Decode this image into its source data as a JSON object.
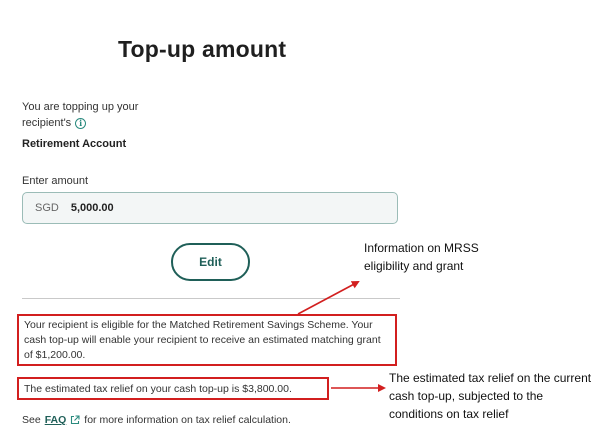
{
  "header": {
    "title": "Top-up amount"
  },
  "intro": {
    "line1": "You are topping up your",
    "line2": "recipient's",
    "account": "Retirement Account",
    "info_icon": "info-icon"
  },
  "amount": {
    "label": "Enter amount",
    "currency": "SGD",
    "value": "5,000.00"
  },
  "actions": {
    "edit_label": "Edit"
  },
  "eligibility": {
    "text": "Your recipient is eligible for the Matched Retirement Savings Scheme. Your cash top-up will enable your recipient to receive an estimated matching grant of $1,200.00."
  },
  "tax_relief": {
    "text": "The estimated tax relief on your cash top-up is $3,800.00."
  },
  "faq": {
    "prefix": "See",
    "link": "FAQ",
    "icon": "external-link-icon",
    "suffix": "for more information on tax relief calculation."
  },
  "annotations": {
    "mrss": "Information on MRSS eligibility and grant",
    "tax": "The estimated tax relief on the current cash top-up, subjected to the conditions on tax relief"
  },
  "colors": {
    "accent": "#1f5f58",
    "highlight": "#d21f1f"
  }
}
